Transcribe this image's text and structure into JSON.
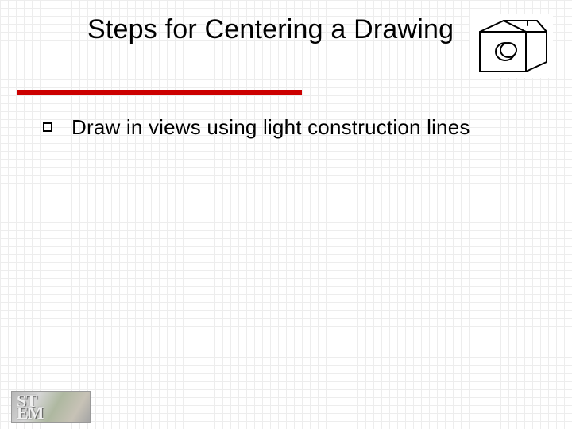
{
  "slide": {
    "title": "Steps for Centering a Drawing",
    "bullets": [
      {
        "text": "Draw in views using light construction lines"
      }
    ]
  },
  "icon": {
    "name": "isometric-block-with-hole"
  },
  "logo": {
    "line1": "ST",
    "line2": "EM"
  },
  "colors": {
    "accent": "#cc0000"
  }
}
